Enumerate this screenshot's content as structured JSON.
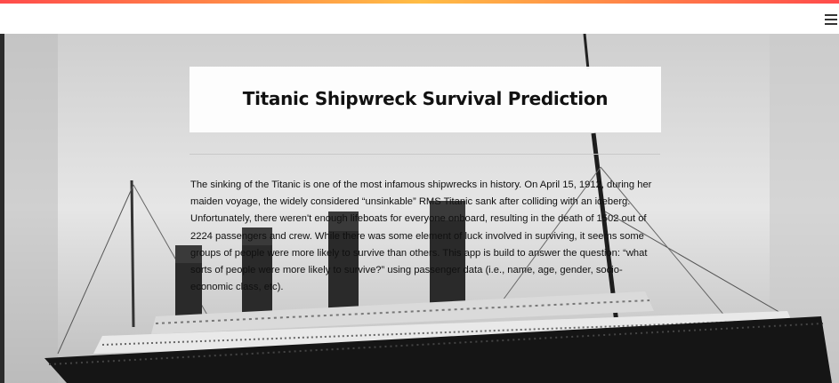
{
  "app": {
    "title": "Titanic Shipwreck Survival Prediction",
    "description": "The sinking of the Titanic is one of the most infamous shipwrecks in history. On April 15, 1912, during her maiden voyage, the widely considered “unsinkable” RMS Titanic sank after colliding with an iceberg. Unfortunately, there weren't enough lifeboats for everyone onboard, resulting in the death of 1502 out of 2224 passengers and crew. While there was some element of luck involved in surviving, it seems some groups of people were more likely to survive than others. This app is build to answer the question: “what sorts of people were more likely to survive?” using passenger data (i.e., name, age, gender, socio-economic class, etc)."
  },
  "header": {
    "menu_icon": "hamburger-menu-icon"
  },
  "background": {
    "image": "titanic-ship-photo"
  },
  "colors": {
    "accent_start": "#ff4b4b",
    "accent_mid": "#ffbd45",
    "text": "#111111"
  }
}
